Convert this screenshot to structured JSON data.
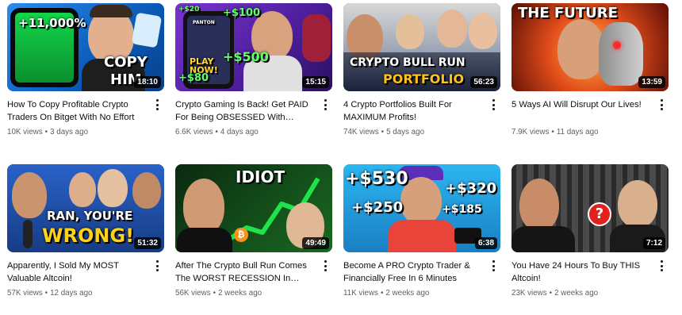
{
  "videos": [
    {
      "title": "How To Copy Profitable Crypto Traders On Bitget With No Effort",
      "views": "10K views",
      "age": "3 days ago",
      "duration": "18:10",
      "thumb_text": [
        "+11,000%",
        "COPY",
        "HIM"
      ],
      "bg": "#0b6fd6"
    },
    {
      "title": "Crypto Gaming Is Back! Get PAID For Being OBSESSED With Fantasy…",
      "views": "6.6K views",
      "age": "4 days ago",
      "duration": "15:15",
      "thumb_text": [
        "+$20",
        "+$100",
        "PLAY NOW!",
        "+$500",
        "+$80",
        "PANTON"
      ],
      "bg": "#6a2db8"
    },
    {
      "title": "4 Crypto Portfolios Built For MAXIMUM Profits!",
      "views": "74K views",
      "age": "5 days ago",
      "duration": "56:23",
      "thumb_text": [
        "CRYPTO BULL RUN",
        "PORTFOLIO"
      ],
      "bg": "#1c2a4a"
    },
    {
      "title": "5 Ways AI Will Disrupt Our Lives!",
      "views": "7.9K views",
      "age": "11 days ago",
      "duration": "13:59",
      "thumb_text": [
        "THE FUTURE"
      ],
      "bg": "#c8361a"
    },
    {
      "title": "Apparently, I Sold My MOST Valuable Altcoin!",
      "views": "57K views",
      "age": "12 days ago",
      "duration": "51:32",
      "thumb_text": [
        "RAN, YOU'RE",
        "WRONG!"
      ],
      "bg": "#1d4fa8"
    },
    {
      "title": "After The Crypto Bull Run Comes The WORST RECESSION In History!",
      "views": "56K views",
      "age": "2 weeks ago",
      "duration": "49:49",
      "thumb_text": [
        "IDIOT"
      ],
      "bg": "#0d3d14"
    },
    {
      "title": "Become A PRO Crypto Trader & Financially Free In 6 Minutes",
      "views": "11K views",
      "age": "2 weeks ago",
      "duration": "6:38",
      "thumb_text": [
        "+$530",
        "+$320",
        "+$250",
        "+$185"
      ],
      "bg": "#1aa7e8"
    },
    {
      "title": "You Have 24 Hours To Buy THIS Altcoin!",
      "views": "23K views",
      "age": "2 weeks ago",
      "duration": "7:12",
      "thumb_text": [
        "?"
      ],
      "bg": "#3a3a3a"
    }
  ]
}
